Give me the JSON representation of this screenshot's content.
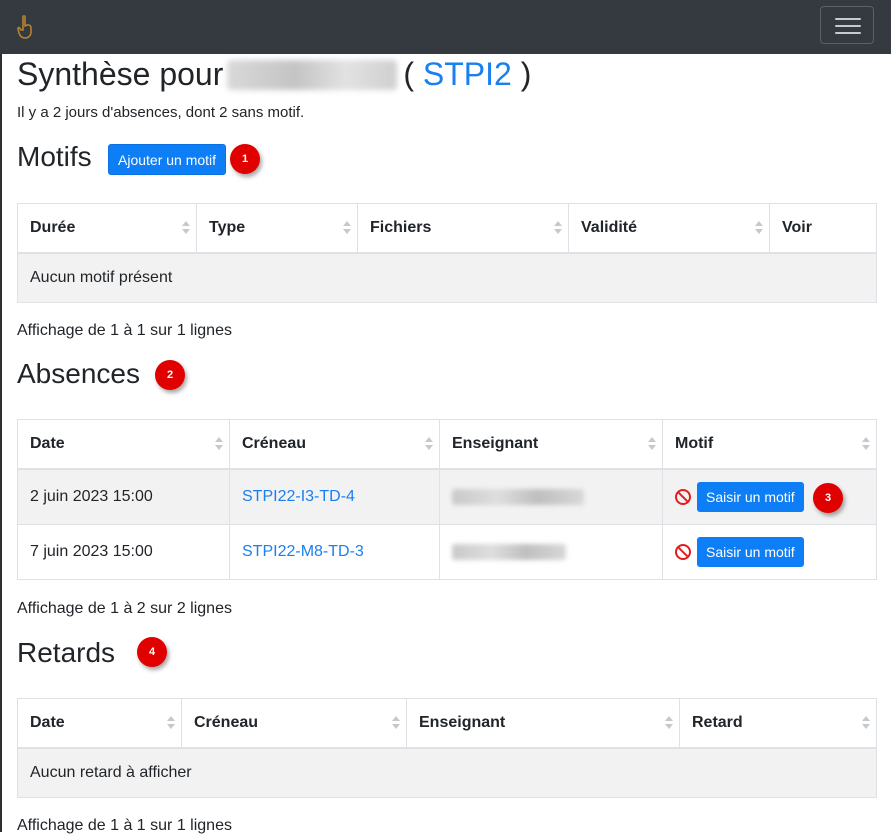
{
  "navbar": {
    "brand_icon": "hand-pointer-icon",
    "menu_icon": "hamburger-menu-icon"
  },
  "page": {
    "title_prefix": "Synthèse pour",
    "title_open": "(",
    "class_link": "STPI2",
    "title_close": ")",
    "subtitle": "Il y a 2 jours d'absences, dont 2 sans motif."
  },
  "motifs": {
    "heading": "Motifs",
    "add_button": "Ajouter un motif",
    "badge": "1",
    "columns": [
      "Durée",
      "Type",
      "Fichiers",
      "Validité",
      "Voir"
    ],
    "empty": "Aucun motif présent",
    "info": "Affichage de 1 à 1 sur 1 lignes"
  },
  "absences": {
    "heading": "Absences",
    "badge": "2",
    "columns": [
      "Date",
      "Créneau",
      "Enseignant",
      "Motif"
    ],
    "rows": [
      {
        "date": "2 juin 2023 15:00",
        "creneau": "STPI22-I3-TD-4",
        "button": "Saisir un motif"
      },
      {
        "date": "7 juin 2023 15:00",
        "creneau": "STPI22-M8-TD-3",
        "button": "Saisir un motif"
      }
    ],
    "row_badge": "3",
    "info": "Affichage de 1 à 2 sur 2 lignes"
  },
  "retards": {
    "heading": "Retards",
    "badge": "4",
    "columns": [
      "Date",
      "Créneau",
      "Enseignant",
      "Retard"
    ],
    "empty": "Aucun retard à afficher",
    "info": "Affichage de 1 à 1 sur 1 lignes"
  },
  "colors": {
    "navbar": "#343a40",
    "link": "#1a7ff0",
    "button": "#0d7ef5",
    "badge": "#e00000",
    "ban": "#e01e1e"
  }
}
